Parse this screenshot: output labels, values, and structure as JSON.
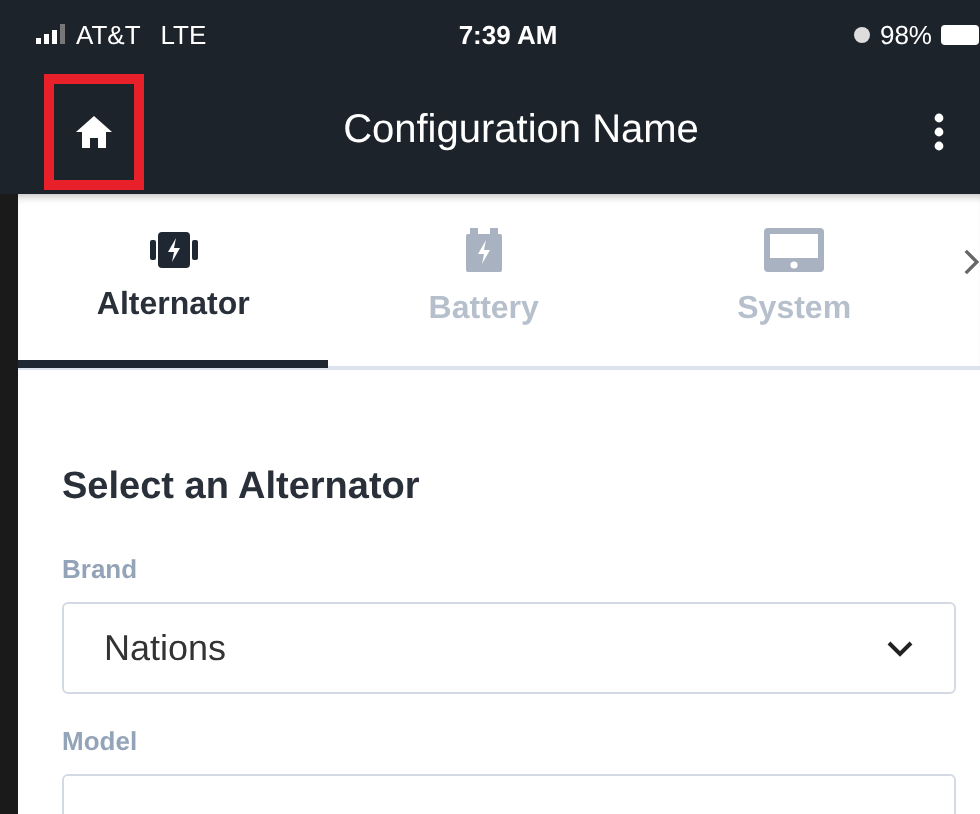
{
  "status_bar": {
    "carrier": "AT&T",
    "network": "LTE",
    "time": "7:39 AM",
    "battery": "98%"
  },
  "app_bar": {
    "title": "Configuration Name",
    "home_highlighted": true
  },
  "tabs": [
    {
      "label": "Alternator",
      "kind": "alternator",
      "selected": true
    },
    {
      "label": "Battery",
      "kind": "battery",
      "selected": false
    },
    {
      "label": "System",
      "kind": "system",
      "selected": false
    }
  ],
  "section": {
    "title": "Select an Alternator"
  },
  "fields": [
    {
      "label": "Brand",
      "value": "Nations",
      "kind": "dropdown"
    },
    {
      "label": "Model",
      "kind": "dropdown"
    }
  ]
}
